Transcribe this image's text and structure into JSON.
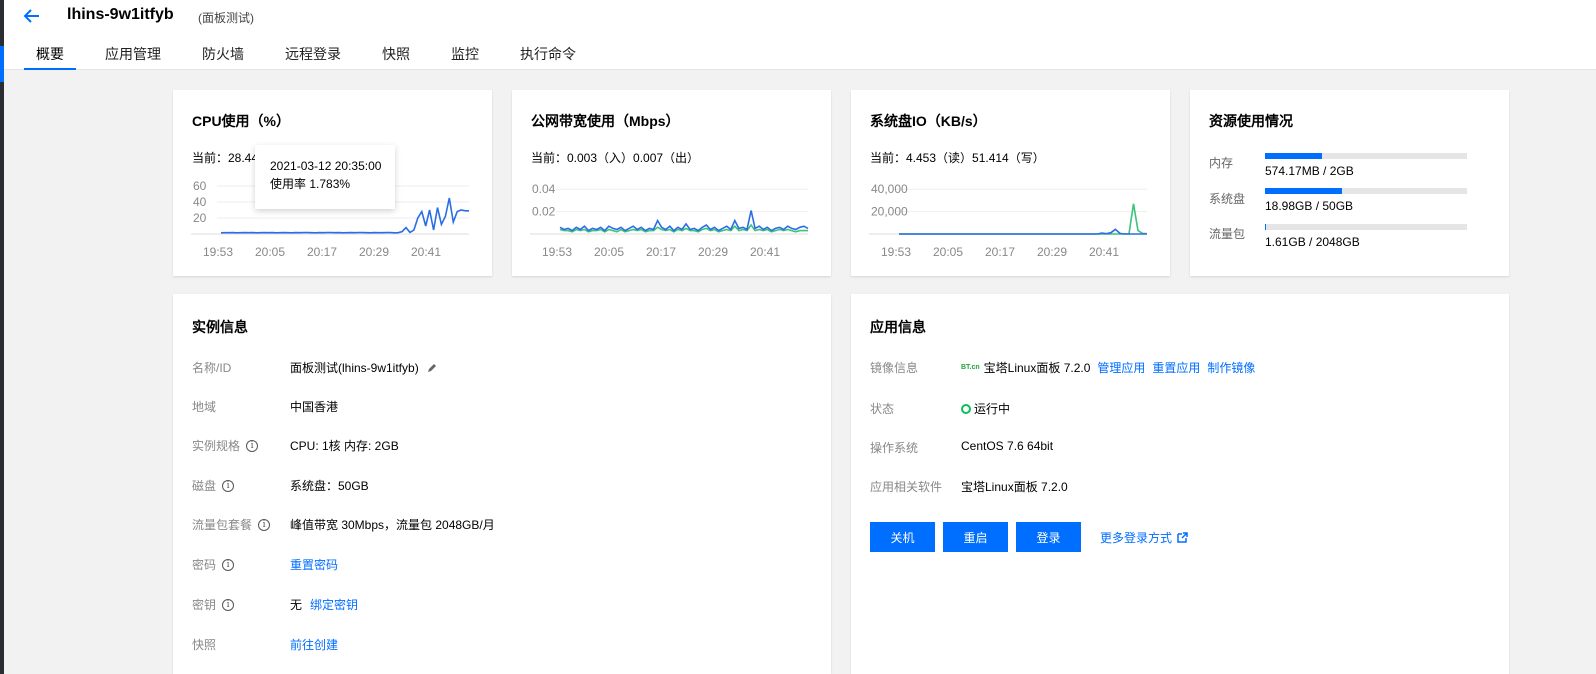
{
  "header": {
    "title": "lhins-9w1itfyb",
    "subtitle": "(面板测试)",
    "tabs": [
      "概要",
      "应用管理",
      "防火墙",
      "远程登录",
      "快照",
      "监控",
      "执行命令"
    ]
  },
  "colors": {
    "accent": "#006eff",
    "series_in": "#2b6de5",
    "series_out": "#3ac47d",
    "running": "#0abf5b"
  },
  "cpu_card": {
    "title": "CPU使用（%）",
    "current": "当前：28.44",
    "tooltip": {
      "time": "2021-03-12 20:35:00",
      "value": "使用率 1.783%"
    }
  },
  "net_card": {
    "title": "公网带宽使用（Mbps）",
    "current": "当前：0.003（入）0.007（出）"
  },
  "disk_card": {
    "title": "系统盘IO（KB/s）",
    "current": "当前：4.453（读）51.414（写）"
  },
  "resource_card": {
    "title": "资源使用情况",
    "items": [
      {
        "label": "内存",
        "value": "574.17MB / 2GB",
        "fraction": 0.28
      },
      {
        "label": "系统盘",
        "value": "18.98GB / 50GB",
        "fraction": 0.38
      },
      {
        "label": "流量包",
        "value": "1.61GB / 2048GB",
        "fraction": 0.001
      }
    ]
  },
  "chart_data": [
    {
      "type": "line",
      "x_ticks": [
        "19:53",
        "20:05",
        "20:17",
        "20:29",
        "20:41"
      ],
      "y_ticks": [
        "20",
        "40",
        "60"
      ],
      "ylim": [
        0,
        70
      ],
      "series": [
        {
          "values": [
            1.5,
            1.6,
            1.6,
            1.7,
            1.5,
            1.6,
            1.8,
            1.6,
            1.7,
            1.5,
            1.6,
            1.7,
            1.6,
            1.8,
            1.5,
            1.6,
            1.7,
            1.6,
            1.5,
            1.7,
            1.6,
            1.8,
            1.7,
            1.6,
            1.5,
            1.7,
            1.6,
            1.7,
            1.8,
            1.6,
            1.7,
            1.5,
            1.6,
            1.7,
            1.6,
            1.8,
            1.7,
            1.6,
            1.5,
            1.7,
            1.6,
            1.6,
            1.8,
            1.7,
            1.5,
            1.6,
            3,
            8,
            2,
            5,
            20,
            28,
            10,
            30,
            5,
            33,
            12,
            22,
            45,
            15,
            28,
            30,
            29,
            29
          ]
        }
      ]
    },
    {
      "type": "line",
      "x_ticks": [
        "19:53",
        "20:05",
        "20:17",
        "20:29",
        "20:41"
      ],
      "y_ticks": [
        "0.02",
        "0.04"
      ],
      "ylim": [
        0,
        0.05
      ],
      "series": [
        {
          "values": [
            0.006,
            0.004,
            0.005,
            0.003,
            0.006,
            0.004,
            0.007,
            0.003,
            0.005,
            0.004,
            0.006,
            0.003,
            0.007,
            0.005,
            0.004,
            0.006,
            0.003,
            0.005,
            0.007,
            0.004,
            0.006,
            0.003,
            0.005,
            0.004,
            0.012,
            0.006,
            0.004,
            0.007,
            0.003,
            0.006,
            0.004,
            0.009,
            0.004,
            0.005,
            0.003,
            0.006,
            0.008,
            0.004,
            0.006,
            0.003,
            0.005,
            0.007,
            0.004,
            0.012,
            0.005,
            0.006,
            0.004,
            0.021,
            0.005,
            0.007,
            0.004,
            0.006,
            0.003,
            0.005,
            0.006,
            0.004,
            0.007,
            0.005,
            0.004,
            0.006,
            0.007,
            0.005
          ]
        },
        {
          "values": [
            0.004,
            0.003,
            0.003,
            0.002,
            0.004,
            0.003,
            0.004,
            0.002,
            0.003,
            0.003,
            0.004,
            0.002,
            0.004,
            0.003,
            0.002,
            0.004,
            0.002,
            0.003,
            0.004,
            0.003,
            0.004,
            0.002,
            0.003,
            0.003,
            0.006,
            0.004,
            0.003,
            0.004,
            0.002,
            0.004,
            0.003,
            0.005,
            0.003,
            0.003,
            0.002,
            0.004,
            0.005,
            0.003,
            0.004,
            0.002,
            0.003,
            0.004,
            0.003,
            0.007,
            0.003,
            0.004,
            0.003,
            0.008,
            0.003,
            0.004,
            0.003,
            0.004,
            0.002,
            0.003,
            0.004,
            0.003,
            0.004,
            0.003,
            0.002,
            0.003,
            0.003,
            0.003
          ]
        }
      ]
    },
    {
      "type": "line",
      "x_ticks": [
        "19:53",
        "20:05",
        "20:17",
        "20:29",
        "20:41"
      ],
      "y_ticks": [
        "20,000",
        "40,000"
      ],
      "ylim": [
        0,
        50000
      ],
      "series": [
        {
          "values": [
            20,
            30,
            25,
            40,
            20,
            30,
            35,
            25,
            20,
            30,
            40,
            25,
            30,
            20,
            35,
            30,
            25,
            40,
            20,
            30,
            25,
            35,
            30,
            20,
            40,
            25,
            30,
            35,
            20,
            30,
            25,
            40,
            30,
            20,
            35,
            25,
            30,
            40,
            20,
            30,
            25,
            35,
            30,
            20,
            40,
            800,
            300,
            1200,
            4200,
            500,
            30,
            40,
            20,
            30,
            25,
            40
          ]
        },
        {
          "values": [
            10,
            10,
            10,
            10,
            10,
            10,
            10,
            10,
            10,
            10,
            10,
            10,
            10,
            10,
            10,
            10,
            10,
            10,
            10,
            10,
            10,
            10,
            10,
            10,
            10,
            10,
            10,
            10,
            10,
            10,
            10,
            10,
            10,
            10,
            10,
            10,
            10,
            10,
            10,
            10,
            10,
            10,
            10,
            10,
            10,
            10,
            10,
            10,
            10,
            10,
            10,
            200,
            27000,
            3000,
            500,
            300
          ]
        }
      ]
    }
  ],
  "instance": {
    "title": "实例信息",
    "rows": [
      {
        "label": "名称/ID",
        "value": "面板测试(lhins-9w1itfyb)"
      },
      {
        "label": "地域",
        "value": "中国香港"
      },
      {
        "label": "实例规格",
        "value": "CPU: 1核 内存: 2GB"
      },
      {
        "label": "磁盘",
        "value": "系统盘：50GB"
      },
      {
        "label": "流量包套餐",
        "value": "峰值带宽 30Mbps，流量包 2048GB/月"
      },
      {
        "label": "密码",
        "value": "重置密码"
      },
      {
        "label": "密钥",
        "value": "无",
        "link": "绑定密钥"
      },
      {
        "label": "快照",
        "value": "前往创建"
      }
    ]
  },
  "app": {
    "title": "应用信息",
    "image_label": "镜像信息",
    "logo_text": "BT.cn",
    "image_value": "宝塔Linux面板 7.2.0",
    "links": [
      "管理应用",
      "重置应用",
      "制作镜像"
    ],
    "status_label": "状态",
    "status_value": "运行中",
    "os_label": "操作系统",
    "os_value": "CentOS 7.6 64bit",
    "software_label": "应用相关软件",
    "software_value": "宝塔Linux面板 7.2.0",
    "buttons": [
      "关机",
      "重启",
      "登录"
    ],
    "more_login": "更多登录方式"
  }
}
